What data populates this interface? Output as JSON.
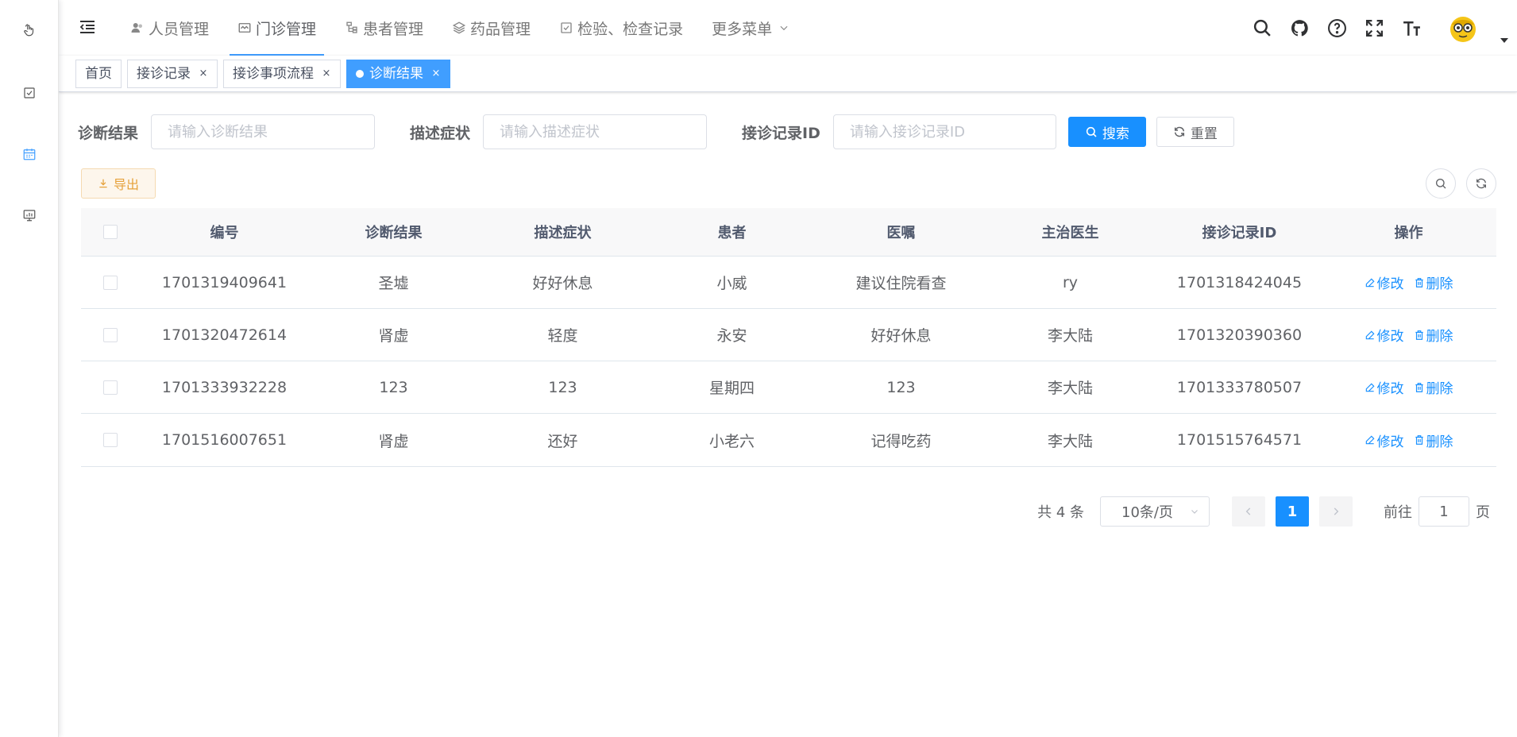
{
  "sidebar": {
    "icons": [
      {
        "name": "pointer-hand-icon"
      },
      {
        "name": "checkbox-icon"
      },
      {
        "name": "calendar-icon"
      },
      {
        "name": "monitor-chart-icon"
      }
    ],
    "active_color": "#409eff"
  },
  "navbar": {
    "menu": [
      {
        "label": "人员管理",
        "icon": "user-group-icon",
        "active": false
      },
      {
        "label": "门诊管理",
        "icon": "clinic-icon",
        "active": true
      },
      {
        "label": "患者管理",
        "icon": "tree-icon",
        "active": false
      },
      {
        "label": "药品管理",
        "icon": "layers-icon",
        "active": false
      },
      {
        "label": "检验、检查记录",
        "icon": "checkbox-icon",
        "active": false
      },
      {
        "label": "更多菜单",
        "icon": "chevron-down-icon",
        "active": false
      }
    ],
    "right_icons": [
      "search-icon",
      "github-icon",
      "help-icon",
      "fullscreen-icon",
      "font-size-icon"
    ]
  },
  "tags": [
    {
      "label": "首页",
      "closable": false,
      "active": false
    },
    {
      "label": "接诊记录",
      "closable": true,
      "active": false
    },
    {
      "label": "接诊事项流程",
      "closable": true,
      "active": false
    },
    {
      "label": "诊断结果",
      "closable": true,
      "active": true
    }
  ],
  "tag_close_glyph": "×",
  "search": {
    "fields": [
      {
        "label": "诊断结果",
        "placeholder": "请输入诊断结果",
        "value": ""
      },
      {
        "label": "描述症状",
        "placeholder": "请输入描述症状",
        "value": ""
      },
      {
        "label": "接诊记录ID",
        "placeholder": "请输入接诊记录ID",
        "value": ""
      }
    ],
    "search_label": "搜索",
    "reset_label": "重置"
  },
  "toolbar": {
    "export_label": "导出"
  },
  "table": {
    "columns": [
      "编号",
      "诊断结果",
      "描述症状",
      "患者",
      "医嘱",
      "主治医生",
      "接诊记录ID",
      "操作"
    ],
    "edit_label": "修改",
    "delete_label": "删除",
    "rows": [
      [
        "1701319409641",
        "圣墟",
        "好好休息",
        "小威",
        "建议住院看查",
        "ry",
        "1701318424045"
      ],
      [
        "1701320472614",
        "肾虚",
        "轻度",
        "永安",
        "好好休息",
        "李大陆",
        "1701320390360"
      ],
      [
        "1701333932228",
        "123",
        "123",
        "星期四",
        "123",
        "李大陆",
        "1701333780507"
      ],
      [
        "1701516007651",
        "肾虚",
        "还好",
        "小老六",
        "记得吃药",
        "李大陆",
        "1701515764571"
      ]
    ]
  },
  "pagination": {
    "total_label": "共 4 条",
    "page_size": "10条/页",
    "current_page": "1",
    "goto_prefix": "前往",
    "goto_value": "1",
    "goto_suffix": "页"
  },
  "colors": {
    "primary": "#1890ff",
    "warning": "#e6a23c"
  }
}
